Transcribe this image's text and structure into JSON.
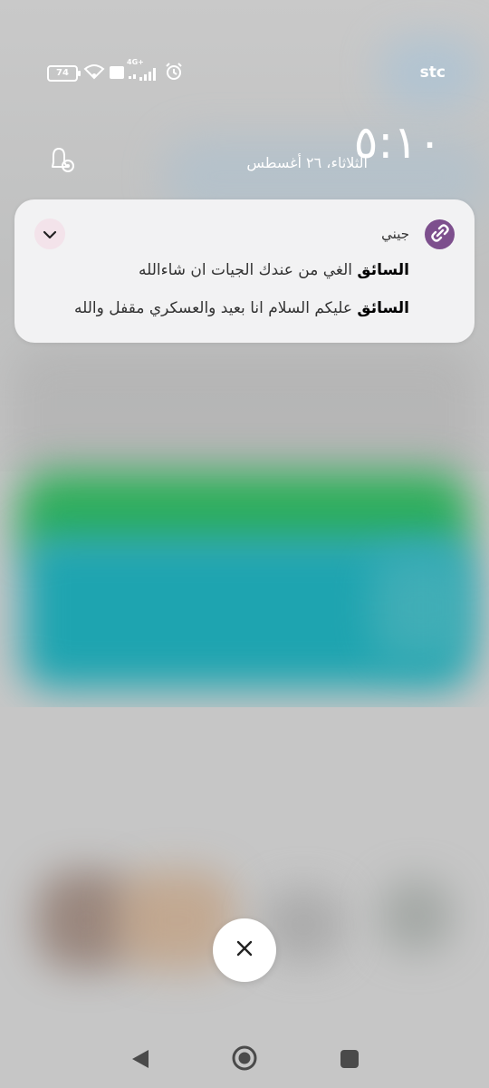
{
  "status_bar": {
    "battery": "74",
    "network": "4G+",
    "carrier": "stc"
  },
  "lockscreen": {
    "time": "٥:١٠",
    "date": "الثلاثاء، ٢٦ أغسطس"
  },
  "notification": {
    "app_name": "جيني",
    "messages": [
      {
        "sender": "السائق",
        "text": "الغي من عندك الجيات ان شاءالله"
      },
      {
        "sender": "السائق",
        "text": "عليكم السلام انا بعيد والعسكري مقفل والله"
      }
    ],
    "colors": {
      "app_icon": "#7d4f8d",
      "card": "#f2f2f3",
      "collapse_button": "#f3e3ea"
    }
  },
  "icons": {
    "close": "close-icon",
    "collapse": "chevron-down-icon",
    "app": "link-icon",
    "notification_settings": "bell-settings-icon",
    "nav_back": "back-triangle-icon",
    "nav_home": "home-circle-icon",
    "nav_recent": "recent-square-icon"
  }
}
